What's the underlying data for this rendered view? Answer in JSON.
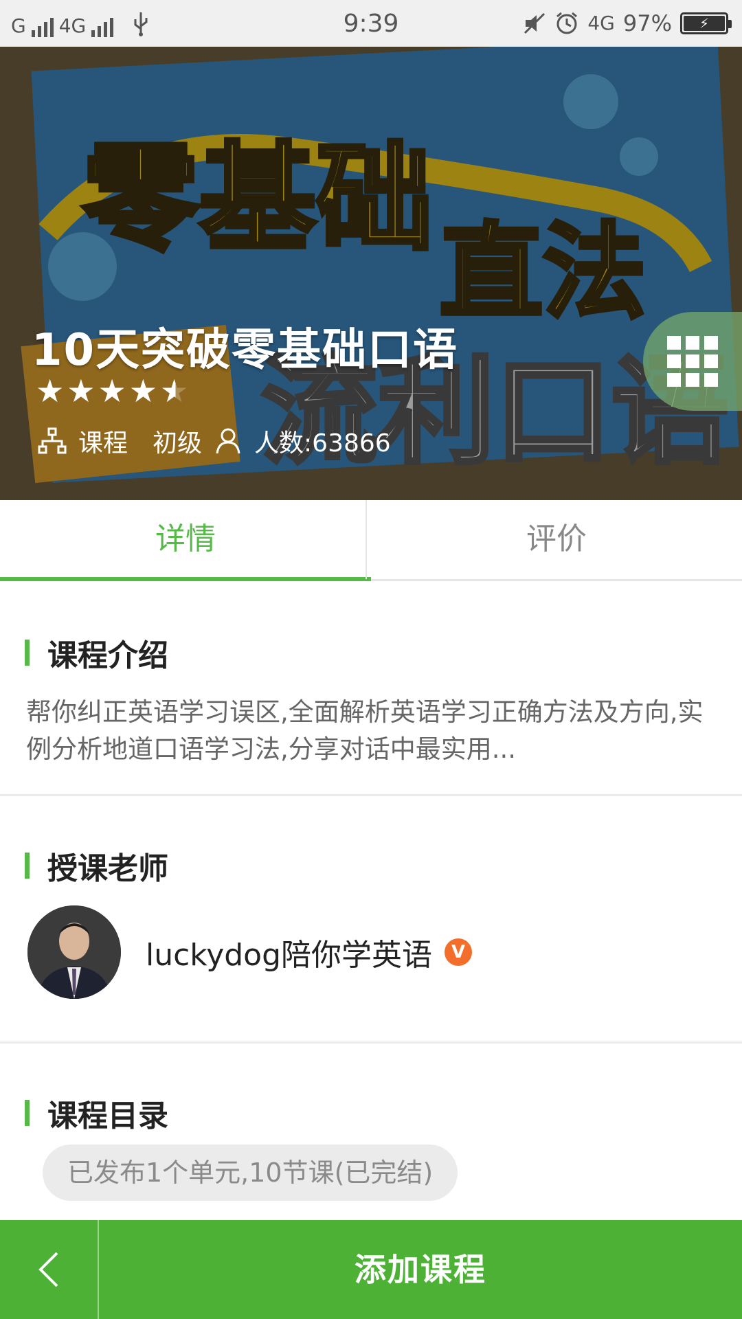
{
  "status_bar": {
    "carrier": "G",
    "network": "4G",
    "time": "9:39",
    "right_network": "4G",
    "battery": "97%",
    "icons": [
      "signal-icon",
      "usb-icon",
      "mute-icon",
      "alarm-icon",
      "battery-icon"
    ]
  },
  "course": {
    "title": "10天突破零基础口语",
    "rating": 4.5,
    "type_label": "课程",
    "level": "初级",
    "learners_label": "人数:",
    "learners_count": "63866"
  },
  "tabs": [
    {
      "label": "详情",
      "active": true
    },
    {
      "label": "评价",
      "active": false
    }
  ],
  "intro": {
    "heading": "课程介绍",
    "text": "帮你纠正英语学习误区,全面解析英语学习正确方法及方向,实例分析地道口语学习法,分享对话中最实用..."
  },
  "teacher": {
    "heading": "授课老师",
    "name": "luckydog陪你学英语",
    "badge": "V"
  },
  "catalog": {
    "heading": "课程目录",
    "summary": "已发布1个单元,10节课(已完结)"
  },
  "bottom_bar": {
    "add_label": "添加课程"
  },
  "colors": {
    "accent": "#56b948",
    "bottom_bar": "#4cb135",
    "badge": "#f36e2a"
  }
}
